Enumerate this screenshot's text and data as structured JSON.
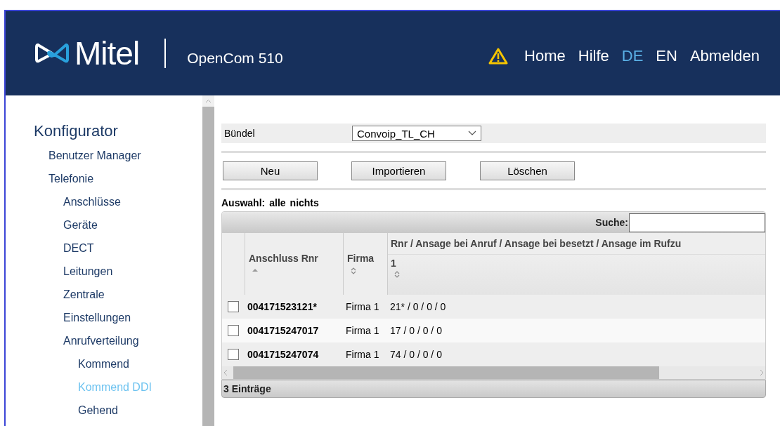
{
  "header": {
    "logo_text": "Mitel",
    "product": "OpenCom 510",
    "warning": true,
    "nav": [
      {
        "label": "Home",
        "selected": false
      },
      {
        "label": "Hilfe",
        "selected": false
      },
      {
        "label": "DE",
        "selected": true
      },
      {
        "label": "EN",
        "selected": false
      },
      {
        "label": "Abmelden",
        "selected": false
      }
    ]
  },
  "sidebar": {
    "title": "Konfigurator",
    "items": [
      {
        "label": "Benutzer Manager",
        "selected": false
      },
      {
        "label": "Telefonie",
        "selected": false,
        "children": [
          {
            "label": "Anschlüsse",
            "selected": false
          },
          {
            "label": "Geräte",
            "selected": false
          },
          {
            "label": "DECT",
            "selected": false
          },
          {
            "label": "Leitungen",
            "selected": false
          },
          {
            "label": "Zentrale",
            "selected": false
          },
          {
            "label": "Einstellungen",
            "selected": false
          },
          {
            "label": "Anrufverteilung",
            "selected": false,
            "children": [
              {
                "label": "Kommend",
                "selected": false
              },
              {
                "label": "Kommend DDI",
                "selected": true
              },
              {
                "label": "Gehend",
                "selected": false
              }
            ]
          }
        ]
      }
    ]
  },
  "bundle": {
    "label": "Bündel",
    "value": "Convoip_TL_CH"
  },
  "buttons": [
    "Neu",
    "Importieren",
    "Löschen"
  ],
  "selection": {
    "label": "Auswahl:",
    "links": [
      "alle",
      "nichts"
    ]
  },
  "table": {
    "search_label": "Suche:",
    "columns": [
      {
        "label": "Anschluss Rnr",
        "sorted": true
      },
      {
        "label": "Firma",
        "sorted": false
      },
      {
        "label": "Rnr / Ansage bei Anruf / Ansage bei besetzt / Ansage im Rufzu",
        "sublabel": "1",
        "sorted": false
      }
    ],
    "rows": [
      {
        "checked": false,
        "cells": [
          "004171523121*",
          "Firma 1",
          "21* / 0 / 0 / 0"
        ]
      },
      {
        "checked": false,
        "cells": [
          "0041715247017",
          "Firma 1",
          "17 / 0 / 0 / 0"
        ]
      },
      {
        "checked": false,
        "cells": [
          "0041715247074",
          "Firma 1",
          "74 / 0 / 0 / 0"
        ]
      }
    ],
    "footer": "3 Einträge"
  }
}
